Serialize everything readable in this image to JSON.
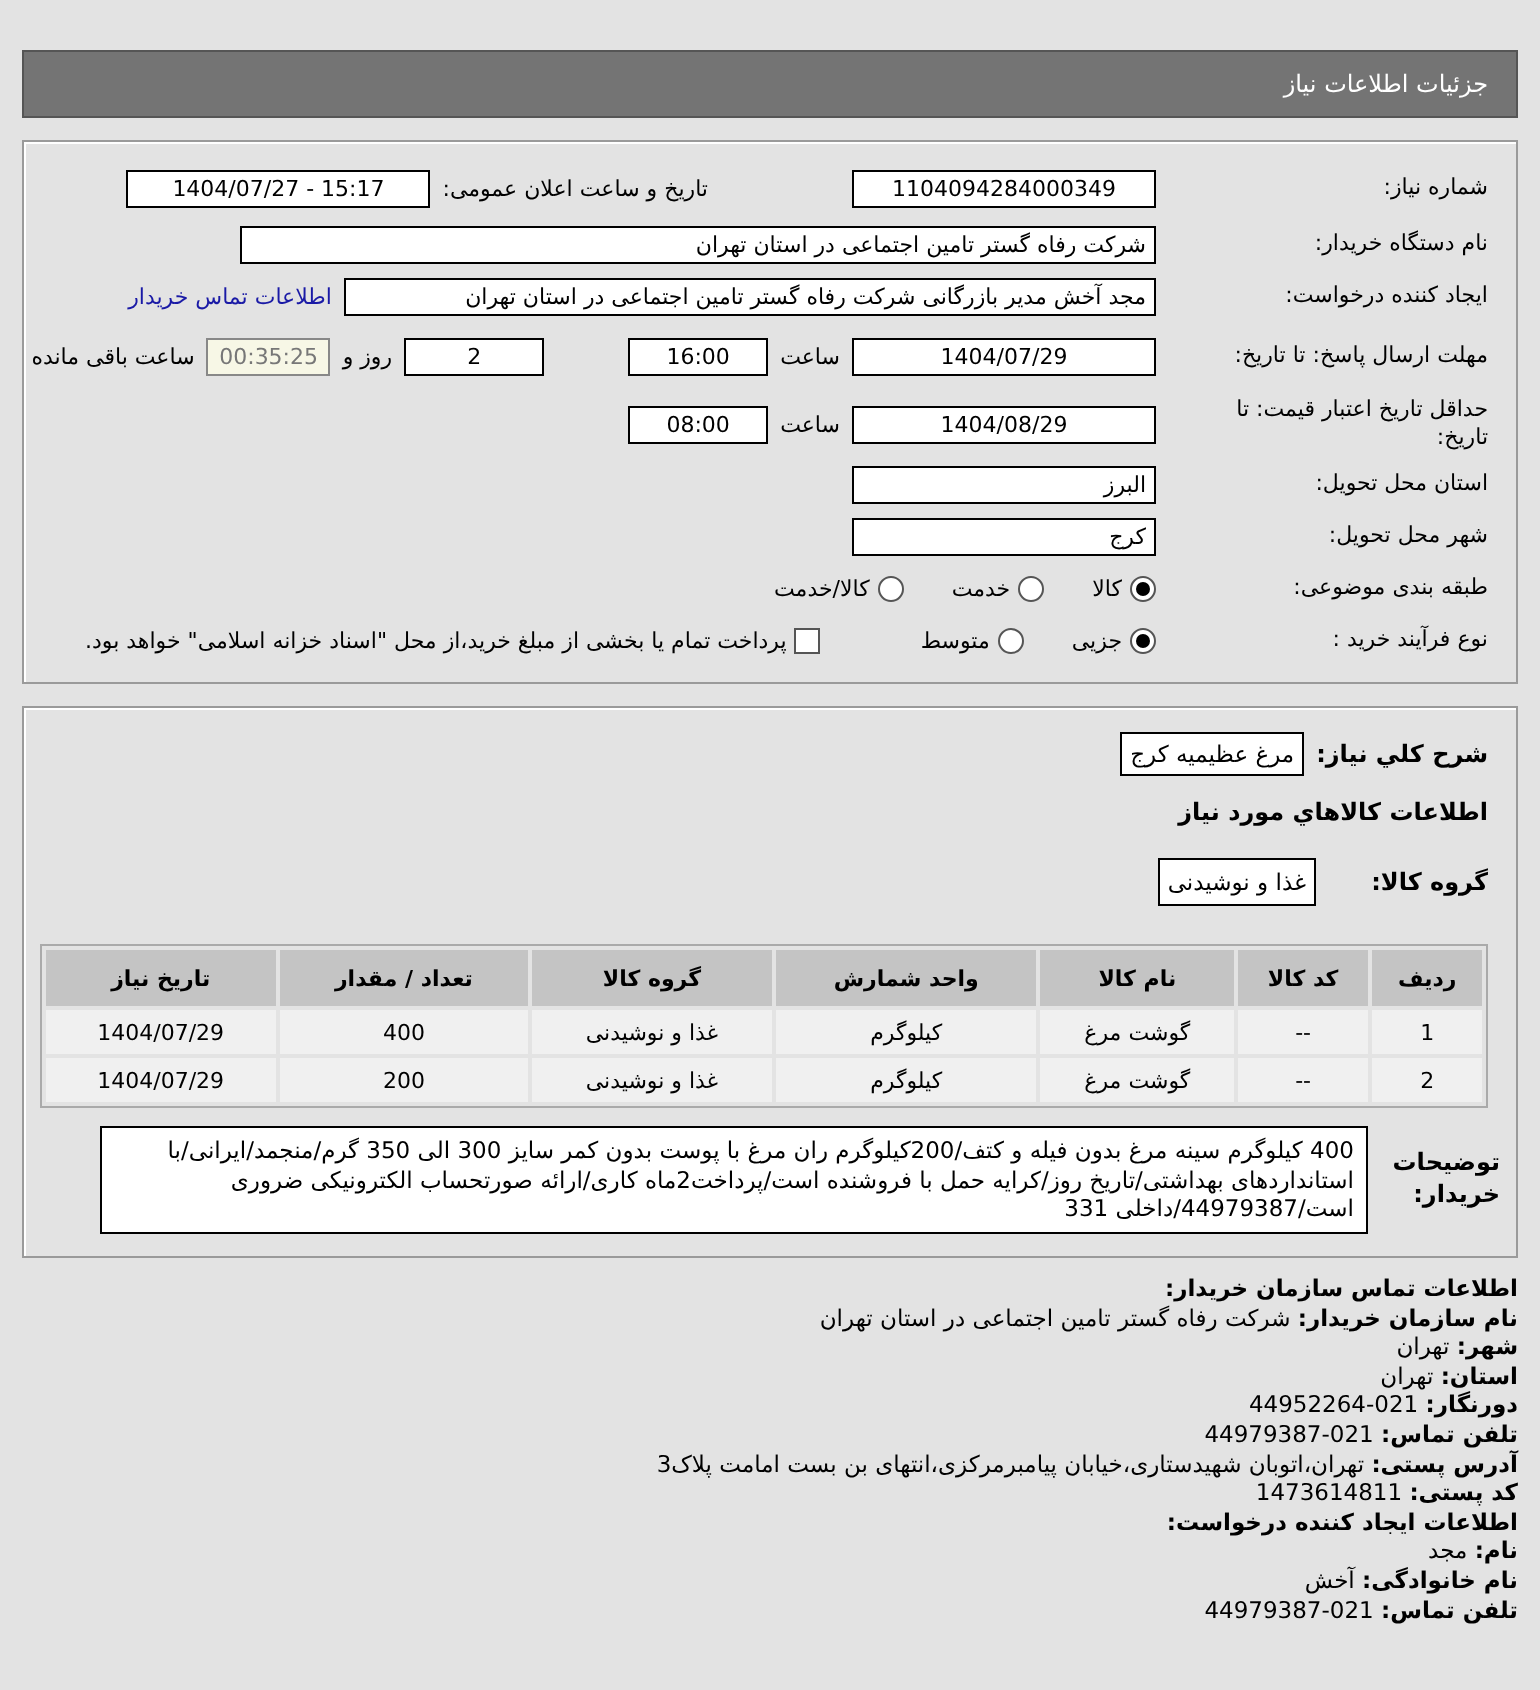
{
  "header": {
    "title": "جزئیات اطلاعات نیاز"
  },
  "need": {
    "number_label": "شماره نیاز:",
    "number": "1104094284000349",
    "announce_label": "تاریخ و ساعت اعلان عمومی:",
    "announce": "1404/07/27 - 15:17",
    "buyer_label": "نام دستگاه خریدار:",
    "buyer": "شرکت رفاه گستر تامین اجتماعی در استان تهران",
    "creator_label": "ایجاد کننده درخواست:",
    "creator": "مجد آخش مدیر بازرگانی شرکت رفاه گستر تامین اجتماعی در استان تهران",
    "contact_link": "اطلاعات تماس خریدار",
    "deadline_label": "مهلت ارسال پاسخ: تا تاریخ:",
    "deadline_date": "1404/07/29",
    "time_label": "ساعت",
    "deadline_time": "16:00",
    "days": "2",
    "days_label": "روز و",
    "remaining": "00:35:25",
    "remaining_label": "ساعت باقی مانده",
    "validity_label": "حداقل تاریخ اعتبار قیمت: تا تاریخ:",
    "validity_date": "1404/08/29",
    "validity_time_label": "ساعت",
    "validity_time": "08:00",
    "province_label": "استان محل تحویل:",
    "province": "البرز",
    "city_label": "شهر محل تحویل:",
    "city": "کرج",
    "category_label": "طبقه بندی موضوعی:",
    "categories": [
      {
        "label": "کالا",
        "selected": true
      },
      {
        "label": "خدمت",
        "selected": false
      },
      {
        "label": "کالا/خدمت",
        "selected": false
      }
    ],
    "process_label": "نوع فرآیند خرید :",
    "processes": [
      {
        "label": "جزیی",
        "selected": true
      },
      {
        "label": "متوسط",
        "selected": false
      }
    ],
    "treasury": {
      "label": "پرداخت تمام یا بخشی از مبلغ خرید،از محل \"اسناد خزانه اسلامی\" خواهد بود.",
      "checked": false
    }
  },
  "goods": {
    "summary_label": "شرح کلي نياز:",
    "summary": "مرغ عظیمیه کرج",
    "heading": "اطلاعات كالاهاي مورد نياز",
    "group_label": "گروه کالا:",
    "group": "غذا و نوشیدنی",
    "columns": [
      "ردیف",
      "کد کالا",
      "نام کالا",
      "واحد شمارش",
      "گروه کالا",
      "تعداد / مقدار",
      "تاریخ نیاز"
    ],
    "rows": [
      [
        "1",
        "--",
        "گوشت مرغ",
        "کیلوگرم",
        "غذا و نوشیدنی",
        "400",
        "1404/07/29"
      ],
      [
        "2",
        "--",
        "گوشت مرغ",
        "کیلوگرم",
        "غذا و نوشیدنی",
        "200",
        "1404/07/29"
      ]
    ],
    "notes_label": "توضیحات خریدار:",
    "notes": "400 کیلوگرم سینه مرغ بدون فیله و کتف/200کیلوگرم ران مرغ با پوست بدون کمر سایز 300 الی 350 گرم/منجمد/ایرانی/با استانداردهای بهداشتی/تاریخ روز/کرایه حمل با فروشنده است/پرداخت2ماه کاری/ارائه صورتحساب الکترونیکی ضروری است/44979387/داخلی 331"
  },
  "contact": {
    "lines": [
      {
        "kind": "heading",
        "text": "اطلاعات تماس سازمان خریدار:"
      },
      {
        "kind": "field",
        "text": "**نام سازمان خریدار:** شرکت رفاه گستر تامین اجتماعی در استان تهران"
      },
      {
        "kind": "field",
        "text": "**شهر:** تهران"
      },
      {
        "kind": "field",
        "text": "**استان:** تهران"
      },
      {
        "kind": "field",
        "text": "**دورنگار:** 021-44952264"
      },
      {
        "kind": "field",
        "text": "**تلفن تماس:** 021-44979387"
      },
      {
        "kind": "field",
        "text": "**آدرس پستی:** تهران،اتوبان شهیدستاری،خیابان پیامبرمرکزی،انتهای بن بست امامت پلاک3"
      },
      {
        "kind": "field",
        "text": "**کد پستی:** 1473614811"
      },
      {
        "kind": "heading",
        "text": "اطلاعات ایجاد کننده درخواست:"
      },
      {
        "kind": "field",
        "text": "**نام:** مجد"
      },
      {
        "kind": "field",
        "text": "**نام خانوادگی:** آخش"
      },
      {
        "kind": "field",
        "text": "**تلفن تماس:** 021-44979387"
      }
    ]
  }
}
